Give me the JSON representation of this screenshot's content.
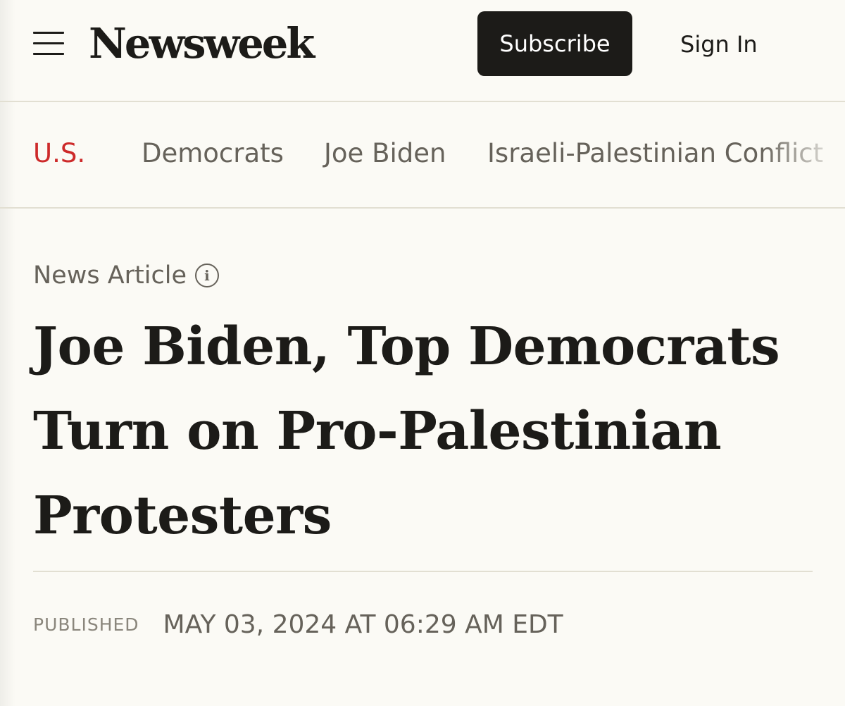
{
  "header": {
    "logo": "Newsweek",
    "subscribe_label": "Subscribe",
    "signin_label": "Sign In"
  },
  "topics": {
    "items": [
      {
        "label": "U.S.",
        "active": true
      },
      {
        "label": "Democrats"
      },
      {
        "label": "Joe Biden"
      },
      {
        "label": "Israeli-Palestinian Conflict"
      }
    ]
  },
  "article": {
    "type_label": "News Article",
    "headline": "Joe Biden, Top Democrats Turn on Pro-Palestinian Protesters",
    "published_label": "PUBLISHED",
    "published_date": "MAY 03, 2024 AT 06:29 AM EDT"
  },
  "colors": {
    "background": "#fbfaf5",
    "text": "#1c1b18",
    "accent_red": "#cd2a2a",
    "muted": "#66625a",
    "divider": "#e2dfd2"
  },
  "icons": {
    "menu": "hamburger-menu-icon",
    "info": "info-icon"
  }
}
